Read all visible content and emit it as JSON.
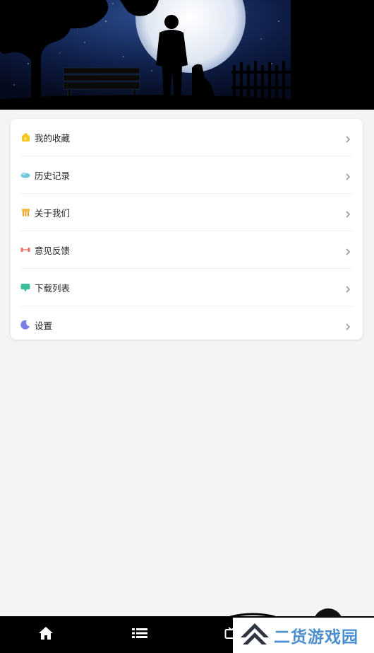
{
  "menu": {
    "items": [
      {
        "label": "我的收藏",
        "icon": "favorites-icon",
        "color": "#f5c518"
      },
      {
        "label": "历史记录",
        "icon": "history-icon",
        "color": "#6cc6d8"
      },
      {
        "label": "关于我们",
        "icon": "about-icon",
        "color": "#f0a020"
      },
      {
        "label": "意见反馈",
        "icon": "feedback-icon",
        "color": "#ef6a6a"
      },
      {
        "label": "下载列表",
        "icon": "download-list-icon",
        "color": "#3bbf9a"
      },
      {
        "label": "设置",
        "icon": "settings-icon",
        "color": "#7b7ee8"
      }
    ]
  },
  "bottom_nav": {
    "items": [
      {
        "icon": "home-icon"
      },
      {
        "icon": "list-icon"
      },
      {
        "icon": "tv-icon"
      }
    ]
  },
  "watermark": {
    "text": "二货游戏园",
    "color": "#4b8fd0"
  }
}
